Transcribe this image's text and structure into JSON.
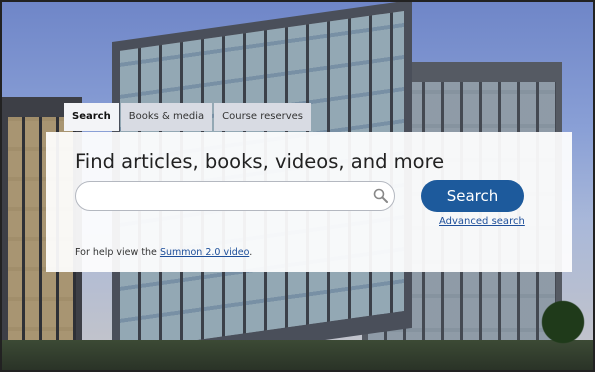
{
  "tabs": [
    {
      "label": "Search",
      "active": true
    },
    {
      "label": "Books & media",
      "active": false
    },
    {
      "label": "Course reserves",
      "active": false
    }
  ],
  "panel": {
    "heading": "Find articles, books, videos, and more",
    "search_input": {
      "value": "",
      "placeholder": ""
    },
    "search_button": "Search",
    "advanced_search": "Advanced search",
    "help": {
      "prefix": "For help view the ",
      "link": "Summon 2.0 video",
      "suffix": "."
    }
  },
  "colors": {
    "search_button": "#1d5a9c",
    "link": "#1e4f9a"
  },
  "icons": {
    "search_field_icon": "magnifier-icon"
  }
}
